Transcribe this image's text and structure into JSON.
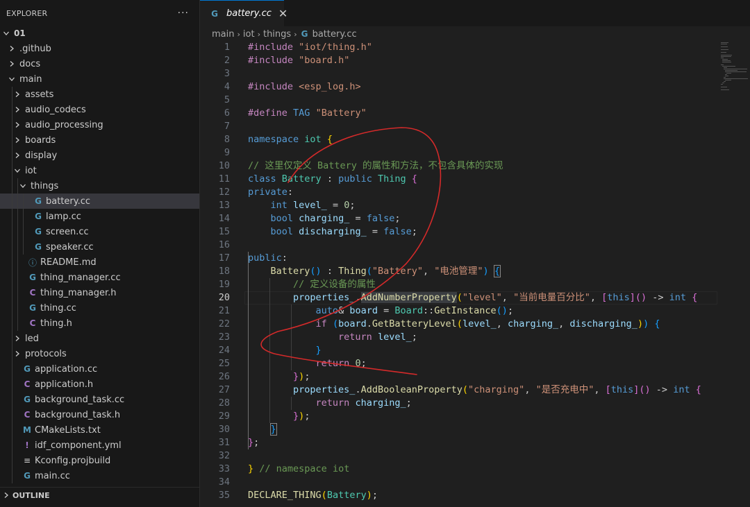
{
  "explorer": {
    "title": "EXPLORER",
    "more": "···",
    "items": [
      {
        "label": "01",
        "depth": 0,
        "kind": "root",
        "open": true
      },
      {
        "label": ".github",
        "depth": 1,
        "kind": "folder",
        "open": false
      },
      {
        "label": "docs",
        "depth": 1,
        "kind": "folder",
        "open": false
      },
      {
        "label": "main",
        "depth": 1,
        "kind": "folder",
        "open": true
      },
      {
        "label": "assets",
        "depth": 2,
        "kind": "folder",
        "open": false
      },
      {
        "label": "audio_codecs",
        "depth": 2,
        "kind": "folder",
        "open": false
      },
      {
        "label": "audio_processing",
        "depth": 2,
        "kind": "folder",
        "open": false
      },
      {
        "label": "boards",
        "depth": 2,
        "kind": "folder",
        "open": false
      },
      {
        "label": "display",
        "depth": 2,
        "kind": "folder",
        "open": false
      },
      {
        "label": "iot",
        "depth": 2,
        "kind": "folder",
        "open": true
      },
      {
        "label": "things",
        "depth": 3,
        "kind": "folder",
        "open": true
      },
      {
        "label": "battery.cc",
        "depth": 4,
        "kind": "cc",
        "active": true
      },
      {
        "label": "lamp.cc",
        "depth": 4,
        "kind": "cc"
      },
      {
        "label": "screen.cc",
        "depth": 4,
        "kind": "cc"
      },
      {
        "label": "speaker.cc",
        "depth": 4,
        "kind": "cc"
      },
      {
        "label": "README.md",
        "depth": 3,
        "kind": "info"
      },
      {
        "label": "thing_manager.cc",
        "depth": 3,
        "kind": "cc"
      },
      {
        "label": "thing_manager.h",
        "depth": 3,
        "kind": "h"
      },
      {
        "label": "thing.cc",
        "depth": 3,
        "kind": "cc"
      },
      {
        "label": "thing.h",
        "depth": 3,
        "kind": "h"
      },
      {
        "label": "led",
        "depth": 2,
        "kind": "folder",
        "open": false
      },
      {
        "label": "protocols",
        "depth": 2,
        "kind": "folder",
        "open": false
      },
      {
        "label": "application.cc",
        "depth": 2,
        "kind": "cc"
      },
      {
        "label": "application.h",
        "depth": 2,
        "kind": "h"
      },
      {
        "label": "background_task.cc",
        "depth": 2,
        "kind": "cc"
      },
      {
        "label": "background_task.h",
        "depth": 2,
        "kind": "h"
      },
      {
        "label": "CMakeLists.txt",
        "depth": 2,
        "kind": "m"
      },
      {
        "label": "idf_component.yml",
        "depth": 2,
        "kind": "yml"
      },
      {
        "label": "Kconfig.projbuild",
        "depth": 2,
        "kind": "kconfig"
      },
      {
        "label": "main.cc",
        "depth": 2,
        "kind": "cc"
      }
    ],
    "outline_label": "OUTLINE"
  },
  "icons": {
    "cc": {
      "glyph": "G",
      "name": "cpp-file-icon"
    },
    "h": {
      "glyph": "C",
      "name": "c-header-file-icon"
    },
    "info": {
      "glyph": "ⓘ",
      "name": "info-file-icon"
    },
    "m": {
      "glyph": "M",
      "name": "cmake-file-icon"
    },
    "yml": {
      "glyph": "!",
      "name": "yaml-file-icon"
    },
    "kconfig": {
      "glyph": "≡",
      "name": "config-file-icon"
    }
  },
  "tab": {
    "label": "battery.cc",
    "close": "✕"
  },
  "breadcrumb": [
    "main",
    "iot",
    "things",
    "battery.cc"
  ],
  "editor": {
    "current_line": 20,
    "lines": [
      [
        [
          "pp",
          "#include"
        ],
        [
          "t",
          " "
        ],
        [
          "str",
          "\"iot/thing.h\""
        ]
      ],
      [
        [
          "pp",
          "#include"
        ],
        [
          "t",
          " "
        ],
        [
          "str",
          "\"board.h\""
        ]
      ],
      [],
      [
        [
          "pp",
          "#include"
        ],
        [
          "t",
          " "
        ],
        [
          "str",
          "<esp_log.h>"
        ]
      ],
      [],
      [
        [
          "pp",
          "#define"
        ],
        [
          "t",
          " "
        ],
        [
          "kw",
          "TAG"
        ],
        [
          "t",
          " "
        ],
        [
          "str",
          "\"Battery\""
        ]
      ],
      [],
      [
        [
          "kw",
          "namespace"
        ],
        [
          "t",
          " "
        ],
        [
          "ty",
          "iot"
        ],
        [
          "t",
          " "
        ],
        [
          "br1",
          "{"
        ]
      ],
      [],
      [
        [
          "cm",
          "// 这里仅定义 Battery 的属性和方法，不包含具体的实现"
        ]
      ],
      [
        [
          "kw",
          "class"
        ],
        [
          "t",
          " "
        ],
        [
          "ty",
          "Battery"
        ],
        [
          "t",
          " : "
        ],
        [
          "kw",
          "public"
        ],
        [
          "t",
          " "
        ],
        [
          "ty",
          "Thing"
        ],
        [
          "t",
          " "
        ],
        [
          "br2",
          "{"
        ]
      ],
      [
        [
          "kw",
          "private"
        ],
        [
          "t",
          ":"
        ]
      ],
      [
        [
          "t",
          "    "
        ],
        [
          "kw",
          "int"
        ],
        [
          "t",
          " "
        ],
        [
          "var",
          "level_"
        ],
        [
          "t",
          " = "
        ],
        [
          "num",
          "0"
        ],
        [
          "t",
          ";"
        ]
      ],
      [
        [
          "t",
          "    "
        ],
        [
          "kw",
          "bool"
        ],
        [
          "t",
          " "
        ],
        [
          "var",
          "charging_"
        ],
        [
          "t",
          " = "
        ],
        [
          "kw",
          "false"
        ],
        [
          "t",
          ";"
        ]
      ],
      [
        [
          "t",
          "    "
        ],
        [
          "kw",
          "bool"
        ],
        [
          "t",
          " "
        ],
        [
          "var",
          "discharging_"
        ],
        [
          "t",
          " = "
        ],
        [
          "kw",
          "false"
        ],
        [
          "t",
          ";"
        ]
      ],
      [],
      [
        [
          "kw",
          "public"
        ],
        [
          "t",
          ":"
        ]
      ],
      [
        [
          "t",
          "    "
        ],
        [
          "fn",
          "Battery"
        ],
        [
          "br3",
          "()"
        ],
        [
          "t",
          " : "
        ],
        [
          "fn",
          "Thing"
        ],
        [
          "br3",
          "("
        ],
        [
          "str",
          "\"Battery\""
        ],
        [
          "t",
          ", "
        ],
        [
          "str",
          "\"电池管理\""
        ],
        [
          "br3",
          ")"
        ],
        [
          "t",
          " "
        ],
        [
          "br3m",
          "{"
        ]
      ],
      [
        [
          "t",
          "        "
        ],
        [
          "cm",
          "// 定义设备的属性"
        ]
      ],
      [
        [
          "t",
          "        "
        ],
        [
          "var",
          "properties_"
        ],
        [
          "t",
          "."
        ],
        [
          "fnhl",
          "AddNumberProperty"
        ],
        [
          "br1",
          "("
        ],
        [
          "str",
          "\"level\""
        ],
        [
          "t",
          ", "
        ],
        [
          "str",
          "\"当前电量百分比\""
        ],
        [
          "t",
          ", "
        ],
        [
          "br2",
          "["
        ],
        [
          "kw",
          "this"
        ],
        [
          "br2",
          "]"
        ],
        [
          "br2",
          "()"
        ],
        [
          "t",
          " -> "
        ],
        [
          "kw",
          "int"
        ],
        [
          "t",
          " "
        ],
        [
          "br2",
          "{"
        ]
      ],
      [
        [
          "t",
          "            "
        ],
        [
          "kw",
          "auto"
        ],
        [
          "t",
          "& "
        ],
        [
          "var",
          "board"
        ],
        [
          "t",
          " = "
        ],
        [
          "ty",
          "Board"
        ],
        [
          "t",
          "::"
        ],
        [
          "fn",
          "GetInstance"
        ],
        [
          "br3",
          "()"
        ],
        [
          "t",
          ";"
        ]
      ],
      [
        [
          "t",
          "            "
        ],
        [
          "ctl",
          "if"
        ],
        [
          "t",
          " "
        ],
        [
          "br3",
          "("
        ],
        [
          "var",
          "board"
        ],
        [
          "t",
          "."
        ],
        [
          "fn",
          "GetBatteryLevel"
        ],
        [
          "br1",
          "("
        ],
        [
          "var",
          "level_"
        ],
        [
          "t",
          ", "
        ],
        [
          "var",
          "charging_"
        ],
        [
          "t",
          ", "
        ],
        [
          "var",
          "discharging_"
        ],
        [
          "br1",
          ")"
        ],
        [
          "br3",
          ")"
        ],
        [
          "t",
          " "
        ],
        [
          "br3",
          "{"
        ]
      ],
      [
        [
          "t",
          "                "
        ],
        [
          "ctl",
          "return"
        ],
        [
          "t",
          " "
        ],
        [
          "var",
          "level_"
        ],
        [
          "t",
          ";"
        ]
      ],
      [
        [
          "t",
          "            "
        ],
        [
          "br3",
          "}"
        ]
      ],
      [
        [
          "t",
          "            "
        ],
        [
          "ctl",
          "return"
        ],
        [
          "t",
          " "
        ],
        [
          "num",
          "0"
        ],
        [
          "t",
          ";"
        ]
      ],
      [
        [
          "t",
          "        "
        ],
        [
          "br2",
          "}"
        ],
        [
          "br1",
          ")"
        ],
        [
          "t",
          ";"
        ]
      ],
      [
        [
          "t",
          "        "
        ],
        [
          "var",
          "properties_"
        ],
        [
          "t",
          "."
        ],
        [
          "fn",
          "AddBooleanProperty"
        ],
        [
          "br1",
          "("
        ],
        [
          "str",
          "\"charging\""
        ],
        [
          "t",
          ", "
        ],
        [
          "str",
          "\"是否充电中\""
        ],
        [
          "t",
          ", "
        ],
        [
          "br2",
          "["
        ],
        [
          "kw",
          "this"
        ],
        [
          "br2",
          "]"
        ],
        [
          "br2",
          "()"
        ],
        [
          "t",
          " -> "
        ],
        [
          "kw",
          "int"
        ],
        [
          "t",
          " "
        ],
        [
          "br2",
          "{"
        ]
      ],
      [
        [
          "t",
          "            "
        ],
        [
          "ctl",
          "return"
        ],
        [
          "t",
          " "
        ],
        [
          "var",
          "charging_"
        ],
        [
          "t",
          ";"
        ]
      ],
      [
        [
          "t",
          "        "
        ],
        [
          "br2",
          "}"
        ],
        [
          "br1",
          ")"
        ],
        [
          "t",
          ";"
        ]
      ],
      [
        [
          "t",
          "    "
        ],
        [
          "br3m",
          "}"
        ]
      ],
      [
        [
          "br2",
          "}"
        ],
        [
          "t",
          ";"
        ]
      ],
      [],
      [
        [
          "br1",
          "}"
        ],
        [
          "t",
          " "
        ],
        [
          "cm",
          "// namespace iot"
        ]
      ],
      [],
      [
        [
          "fn",
          "DECLARE_THING"
        ],
        [
          "br1",
          "("
        ],
        [
          "ty",
          "Battery"
        ],
        [
          "br1",
          ")"
        ],
        [
          "t",
          ";"
        ]
      ]
    ]
  },
  "annotation": {
    "color": "#d42a2a"
  }
}
